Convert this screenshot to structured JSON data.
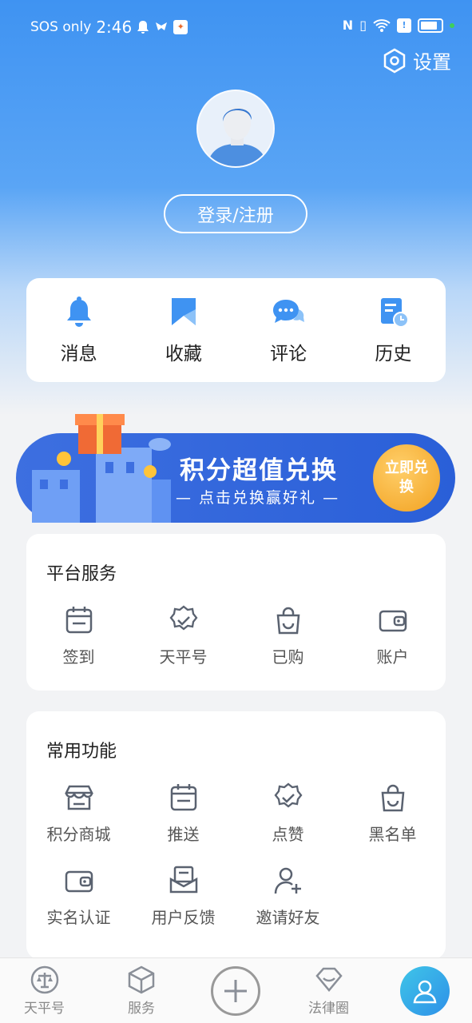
{
  "status_bar": {
    "carrier": "SOS only",
    "time": "2:46"
  },
  "header": {
    "settings_label": "设置",
    "login_label": "登录/注册"
  },
  "quick_actions": [
    {
      "label": "消息",
      "icon": "bell-icon"
    },
    {
      "label": "收藏",
      "icon": "bookmark-icon"
    },
    {
      "label": "评论",
      "icon": "comment-icon"
    },
    {
      "label": "历史",
      "icon": "history-icon"
    }
  ],
  "banner": {
    "title": "积分超值兑换",
    "subtitle": "— 点击兑换赢好礼 —",
    "button": "立即兑换"
  },
  "platform_services": {
    "title": "平台服务",
    "items": [
      {
        "label": "签到",
        "icon": "calendar-icon"
      },
      {
        "label": "天平号",
        "icon": "badge-check-icon"
      },
      {
        "label": "已购",
        "icon": "shopping-bag-icon"
      },
      {
        "label": "账户",
        "icon": "wallet-icon"
      }
    ]
  },
  "common_functions": {
    "title": "常用功能",
    "items": [
      {
        "label": "积分商城",
        "icon": "store-icon"
      },
      {
        "label": "推送",
        "icon": "calendar-icon"
      },
      {
        "label": "点赞",
        "icon": "badge-check-icon"
      },
      {
        "label": "黑名单",
        "icon": "shopping-bag-icon"
      },
      {
        "label": "实名认证",
        "icon": "wallet-icon"
      },
      {
        "label": "用户反馈",
        "icon": "feedback-icon"
      },
      {
        "label": "邀请好友",
        "icon": "add-user-icon"
      }
    ]
  },
  "tabbar": {
    "tab1": "天平号",
    "tab2": "服务",
    "tab4": "法律圈"
  },
  "colors": {
    "primary": "#3f93f2",
    "accent_orange": "#f2a120"
  }
}
